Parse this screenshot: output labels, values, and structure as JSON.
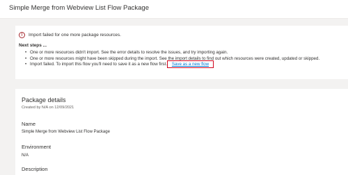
{
  "header": {
    "title": "Simple Merge from Webview List Flow Package"
  },
  "error_panel": {
    "icon": "error-circle-icon",
    "message": "Import failed for one more package resources.",
    "next_steps_title": "Next steps ...",
    "steps": [
      "One or more resources didn't import. See the error details to resolve the issues, and try importing again.",
      "One or more resources might have been skipped during the import. See the import details to find out which resources were created, updated or skipped.",
      "Import failed. To import this flow you'll need to save it as a new flow first."
    ],
    "save_link_label": "Save as a new flow"
  },
  "details": {
    "title": "Package details",
    "created_by": "Created by N/A on 12/09/2021",
    "fields": [
      {
        "label": "Name",
        "value": "Simple Merge from Webview List Flow Package"
      },
      {
        "label": "Environment",
        "value": "N/A"
      },
      {
        "label": "Description",
        "value": ""
      }
    ]
  },
  "colors": {
    "error": "#a4262c",
    "link": "#0078d4",
    "highlight_box": "#d0021b",
    "background": "#f3f2f1"
  }
}
